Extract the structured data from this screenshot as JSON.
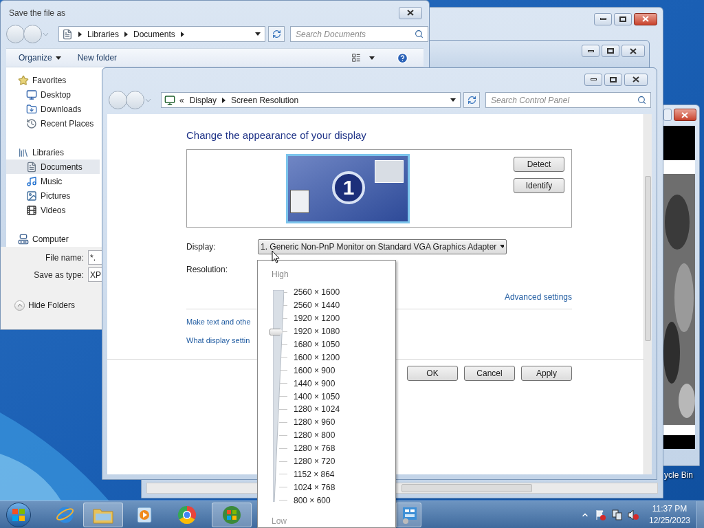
{
  "save_dialog": {
    "title": "Save the file as",
    "breadcrumb": [
      "Libraries",
      "Documents"
    ],
    "search_placeholder": "Search Documents",
    "toolbar": [
      "Organize",
      "New folder"
    ],
    "nav": [
      {
        "label": "Favorites",
        "selected": false,
        "children": [
          {
            "label": "Desktop",
            "selected": false
          },
          {
            "label": "Downloads",
            "selected": false
          },
          {
            "label": "Recent Places",
            "selected": false
          }
        ]
      },
      {
        "label": "Libraries",
        "selected": false,
        "children": [
          {
            "label": "Documents",
            "selected": true
          },
          {
            "label": "Music",
            "selected": false
          },
          {
            "label": "Pictures",
            "selected": false
          },
          {
            "label": "Videos",
            "selected": false
          }
        ]
      },
      {
        "label": "Computer",
        "selected": false
      }
    ],
    "fields": [
      {
        "label": "File name:",
        "value": "*."
      },
      {
        "label": "Save as type:",
        "value": "XP"
      }
    ],
    "hide_folders": "Hide Folders"
  },
  "display_window": {
    "breadcrumb_prefix": "«",
    "breadcrumb": [
      "Display",
      "Screen Resolution"
    ],
    "search_placeholder": "Search Control Panel",
    "heading": "Change the appearance of your display",
    "monitor_number": "1",
    "side_buttons": [
      "Detect",
      "Identify"
    ],
    "display_label": "Display:",
    "display_value": "1. Generic Non-PnP Monitor on Standard VGA Graphics Adapter",
    "resolution_label": "Resolution:",
    "advanced_link": "Advanced settings",
    "links": [
      "Make text and othe",
      "What display settin"
    ],
    "buttons": [
      "OK",
      "Cancel",
      "Apply"
    ]
  },
  "resolution_popup": {
    "high": "High",
    "low": "Low",
    "level": 0.8125,
    "options": [
      "2560 × 1600",
      "2560 × 1440",
      "1920 × 1200",
      "1920 × 1080",
      "1680 × 1050",
      "1600 × 1200",
      "1600 × 900",
      "1440 × 900",
      "1400 × 1050",
      "1280 × 1024",
      "1280 × 960",
      "1280 × 800",
      "1280 × 768",
      "1280 × 720",
      "1152 × 864",
      "1024 × 768",
      "800 × 600"
    ]
  },
  "desktop_icon_label": "ycle Bin",
  "taskbar": {
    "buttons": [
      {
        "open": false
      },
      {
        "open": true
      },
      {
        "open": false
      },
      {
        "open": false
      },
      {
        "open": true
      }
    ],
    "control_button": {
      "open": true
    },
    "time": "11:37 PM",
    "date": "12/25/2023"
  }
}
